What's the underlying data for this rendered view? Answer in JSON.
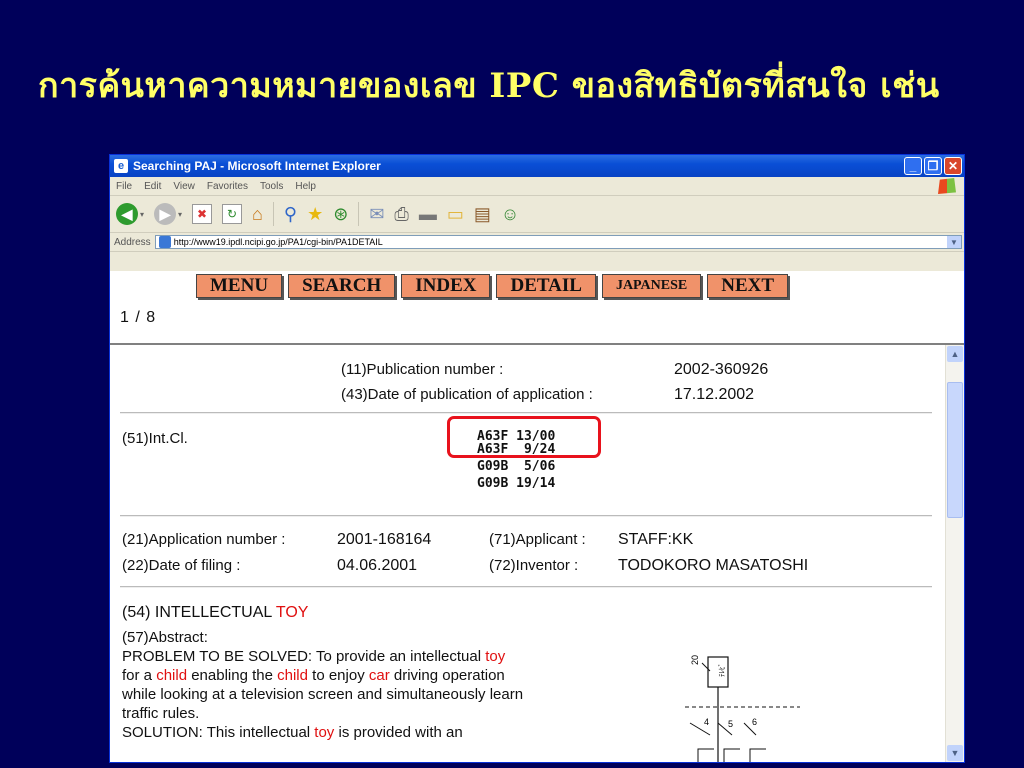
{
  "slide": {
    "title": "การค้นหาความหมายของเลข IPC ของสิทธิบัตรที่สนใจ เช่น"
  },
  "browser": {
    "window_title": "Searching PAJ - Microsoft Internet Explorer",
    "menu": [
      "File",
      "Edit",
      "View",
      "Favorites",
      "Tools",
      "Help"
    ],
    "address_label": "Address",
    "address_url": "http://www19.ipdl.ncipi.go.jp/PA1/cgi-bin/PA1DETAIL"
  },
  "nav_buttons": [
    "MENU",
    "SEARCH",
    "INDEX",
    "DETAIL",
    "JAPANESE",
    "NEXT"
  ],
  "pager": "1 / 8",
  "record": {
    "pub_number_label": "(11)Publication number :",
    "pub_number": "2002-360926",
    "pub_date_label": "(43)Date of publication of application :",
    "pub_date": "17.12.2002",
    "intcl_label": "(51)Int.Cl.",
    "intcl_codes": [
      "A63F 13/00",
      "A63F  9/24",
      "G09B  5/06",
      "G09B 19/14"
    ],
    "app_number_label": "(21)Application number :",
    "app_number": "2001-168164",
    "applicant_label": "(71)Applicant :",
    "applicant": "STAFF:KK",
    "filing_label": "(22)Date of filing :",
    "filing_date": "04.06.2001",
    "inventor_label": "(72)Inventor :",
    "inventor": "TODOKORO MASATOSHI",
    "title_label": "(54)",
    "title_word1": "INTELLECTUAL",
    "title_word2": "TOY",
    "abstract_label": "(57)Abstract:",
    "abstract_lines": [
      [
        "PROBLEM TO BE SOLVED: To provide an intellectual ",
        "toy",
        ""
      ],
      [
        "for a ",
        "child",
        " enabling the "
      ],
      [
        "",
        "child",
        " to enjoy "
      ],
      [
        "",
        "car",
        " driving operation"
      ],
      [
        "while looking at a television screen and simultaneously learn",
        "",
        ""
      ],
      [
        "traffic rules.",
        "",
        ""
      ],
      [
        "SOLUTION: This intellectual ",
        "toy",
        " is provided with an"
      ]
    ],
    "drawing_labels": [
      "20",
      "4",
      "5",
      "6"
    ]
  },
  "colors": {
    "slide_bg": "#00005a",
    "title_color": "#ffff66",
    "button_bg": "#f0926a",
    "highlight": "#e8121c",
    "keyword_red": "#e01010"
  }
}
